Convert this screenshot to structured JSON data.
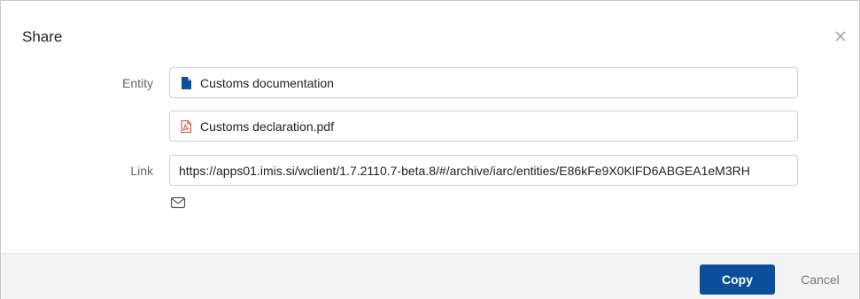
{
  "dialog": {
    "title": "Share"
  },
  "entity": {
    "label": "Entity",
    "document": {
      "name": "Customs documentation",
      "icon": "document-icon",
      "icon_color": "#0b4f9c"
    },
    "attachment": {
      "name": "Customs declaration.pdf",
      "icon": "pdf-icon",
      "icon_color": "#e0443a"
    }
  },
  "link": {
    "label": "Link",
    "value": "https://apps01.imis.si/wclient/1.7.2110.7-beta.8/#/archive/iarc/entities/E86kFe9X0KlFD6ABGEA1eM3RH"
  },
  "actions": {
    "email_icon": "mail-icon",
    "close_icon": "close-icon",
    "copy_label": "Copy",
    "cancel_label": "Cancel"
  },
  "colors": {
    "primary": "#0b4f9c",
    "footer_bg": "#f4f4f4"
  }
}
